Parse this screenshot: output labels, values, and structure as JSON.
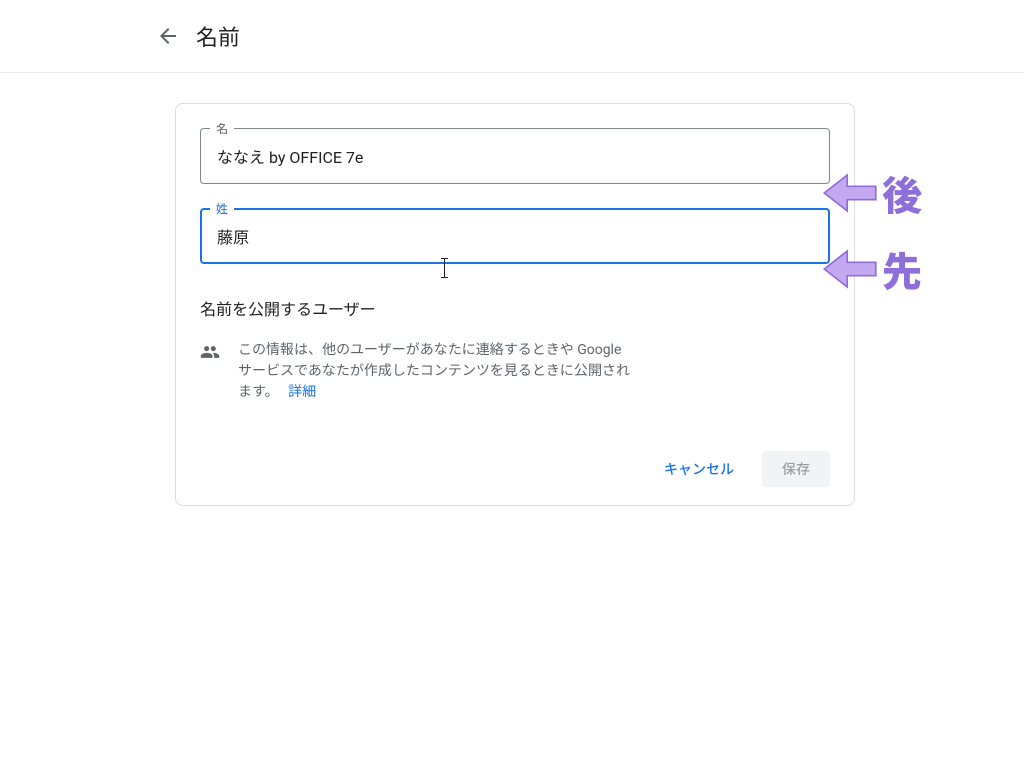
{
  "header": {
    "title": "名前"
  },
  "fields": {
    "given": {
      "label": "名",
      "value": "ななえ by OFFICE 7e"
    },
    "family": {
      "label": "姓",
      "value": "藤原"
    }
  },
  "visibility": {
    "section_title": "名前を公開するユーザー",
    "description": "この情報は、他のユーザーがあなたに連絡するときや Google サービスであなたが作成したコンテンツを見るときに公開されます。",
    "learn_more": "詳細"
  },
  "buttons": {
    "cancel": "キャンセル",
    "save": "保存"
  },
  "annotations": {
    "top": "後",
    "bottom": "先"
  },
  "colors": {
    "accent": "#1a73e8",
    "annotation": "#8e6fd9"
  }
}
